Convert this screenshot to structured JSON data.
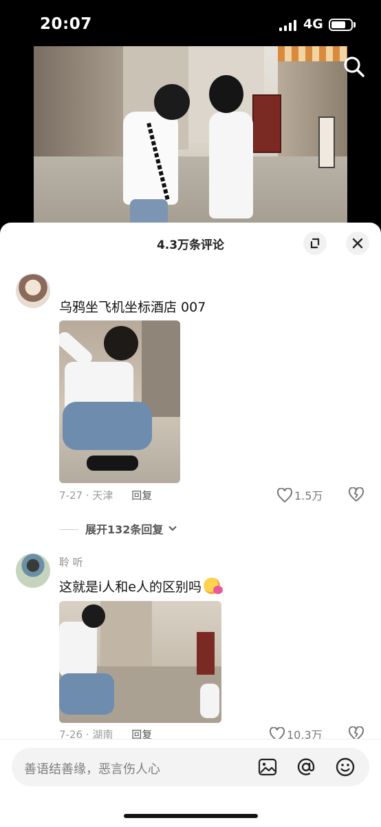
{
  "status_bar": {
    "time": "20:07",
    "network": "4G"
  },
  "sheet": {
    "title": "4.3万条评论"
  },
  "comments": [
    {
      "text": "乌鸦坐飞机坐标酒店 007",
      "date": "7-27",
      "location": "天津",
      "reply_label": "回复",
      "likes": "1.5万",
      "expand_replies": "展开132条回复"
    },
    {
      "username": "聆 听",
      "text": "这就是i人和e人的区别吗",
      "date": "7-26",
      "location": "湖南",
      "reply_label": "回复",
      "likes": "10.3万"
    }
  ],
  "input": {
    "placeholder": "善语结善缘，恶言伤人心"
  },
  "icons": [
    "search-icon",
    "expand-icon",
    "close-icon",
    "heart-icon",
    "broken-heart-icon",
    "image-icon",
    "at-icon",
    "emoji-icon",
    "chevron-down-icon"
  ]
}
